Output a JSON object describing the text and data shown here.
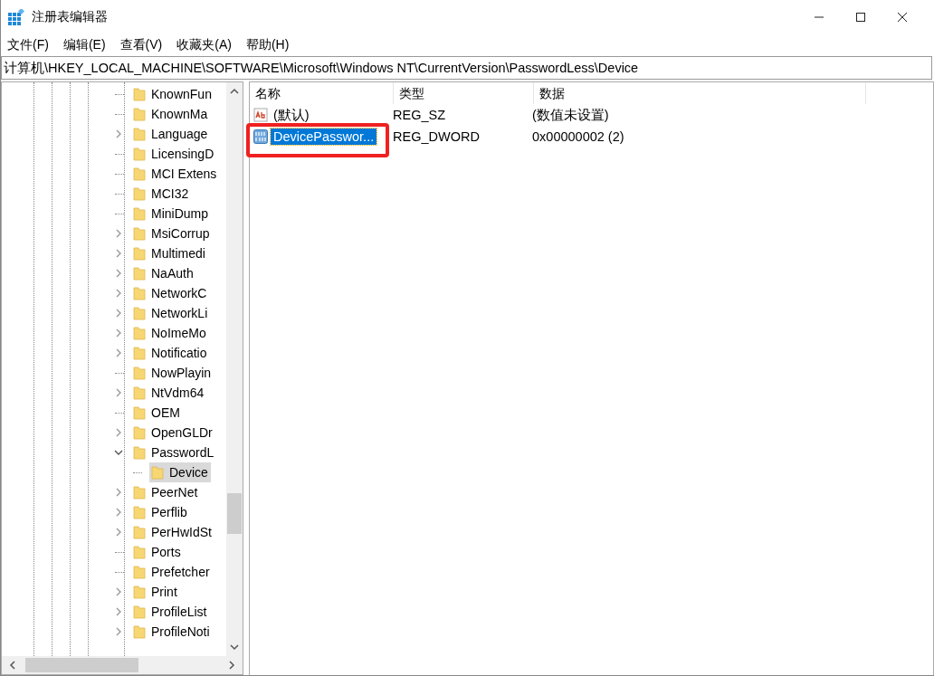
{
  "window": {
    "title": "注册表编辑器"
  },
  "menu": [
    "文件(F)",
    "编辑(E)",
    "查看(V)",
    "收藏夹(A)",
    "帮助(H)"
  ],
  "address": "计算机\\HKEY_LOCAL_MACHINE\\SOFTWARE\\Microsoft\\Windows NT\\CurrentVersion\\PasswordLess\\Device",
  "tree": [
    {
      "label": "KnownFun",
      "kind": "leaf",
      "selected": false
    },
    {
      "label": "KnownMa",
      "kind": "leaf",
      "selected": false
    },
    {
      "label": "Language",
      "kind": "collapsed",
      "selected": false
    },
    {
      "label": "LicensingD",
      "kind": "leaf",
      "selected": false
    },
    {
      "label": "MCI Extens",
      "kind": "leaf",
      "selected": false
    },
    {
      "label": "MCI32",
      "kind": "leaf",
      "selected": false
    },
    {
      "label": "MiniDump",
      "kind": "leaf",
      "selected": false
    },
    {
      "label": "MsiCorrup",
      "kind": "collapsed",
      "selected": false
    },
    {
      "label": "Multimedi",
      "kind": "collapsed",
      "selected": false
    },
    {
      "label": "NaAuth",
      "kind": "collapsed",
      "selected": false
    },
    {
      "label": "NetworkC",
      "kind": "collapsed",
      "selected": false
    },
    {
      "label": "NetworkLi",
      "kind": "collapsed",
      "selected": false
    },
    {
      "label": "NoImeMo",
      "kind": "collapsed",
      "selected": false
    },
    {
      "label": "Notificatio",
      "kind": "collapsed",
      "selected": false
    },
    {
      "label": "NowPlayin",
      "kind": "leaf",
      "selected": false
    },
    {
      "label": "NtVdm64",
      "kind": "collapsed",
      "selected": false
    },
    {
      "label": "OEM",
      "kind": "leaf",
      "selected": false
    },
    {
      "label": "OpenGLDr",
      "kind": "collapsed",
      "selected": false
    },
    {
      "label": "PasswordL",
      "kind": "expanded",
      "selected": false,
      "children": [
        {
          "label": "Device",
          "kind": "leaf",
          "selected": true
        }
      ]
    },
    {
      "label": "PeerNet",
      "kind": "collapsed",
      "selected": false
    },
    {
      "label": "Perflib",
      "kind": "collapsed",
      "selected": false
    },
    {
      "label": "PerHwIdSt",
      "kind": "collapsed",
      "selected": false
    },
    {
      "label": "Ports",
      "kind": "leaf",
      "selected": false
    },
    {
      "label": "Prefetcher",
      "kind": "leaf",
      "selected": false
    },
    {
      "label": "Print",
      "kind": "collapsed",
      "selected": false
    },
    {
      "label": "ProfileList",
      "kind": "collapsed",
      "selected": false
    },
    {
      "label": "ProfileNoti",
      "kind": "collapsed",
      "selected": false
    }
  ],
  "columns": [
    "名称",
    "类型",
    "数据"
  ],
  "values": [
    {
      "name": "(默认)",
      "type": "REG_SZ",
      "data": "(数值未设置)",
      "kind": "string",
      "selected": false,
      "annotated": false
    },
    {
      "name": "DevicePasswor...",
      "type": "REG_DWORD",
      "data": "0x00000002 (2)",
      "kind": "dword",
      "selected": true,
      "annotated": true
    }
  ]
}
